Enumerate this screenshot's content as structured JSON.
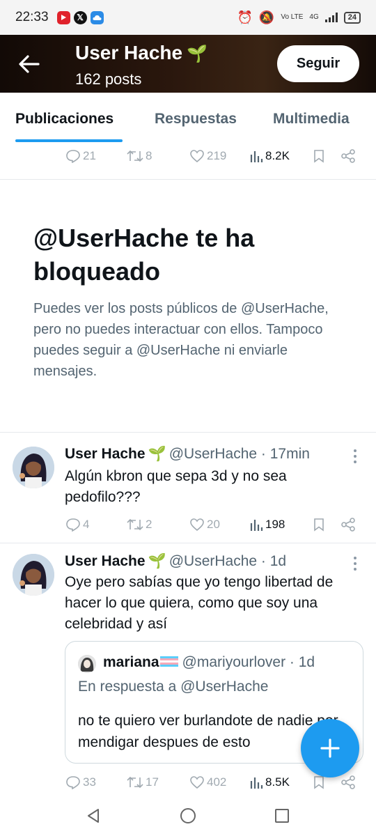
{
  "status_bar": {
    "time": "22:33",
    "notification_icons": [
      "youtube-icon",
      "x-icon",
      "cloud-icon"
    ],
    "volte": "Vo LTE",
    "network": "4G",
    "battery": "24"
  },
  "header": {
    "name": "User Hache",
    "posts_count": "162 posts",
    "follow_label": "Seguir"
  },
  "tabs": [
    {
      "label": "Publicaciones",
      "active": true
    },
    {
      "label": "Respuestas",
      "active": false
    },
    {
      "label": "Multimedia",
      "active": false
    }
  ],
  "top_actions": {
    "replies": "21",
    "reposts": "8",
    "likes": "219",
    "views": "8.2K"
  },
  "blocked": {
    "title": "@UserHache te ha bloqueado",
    "description": "Puedes ver los posts públicos de @UserHache, pero no puedes interactuar con ellos. Tampoco puedes seguir a @UserHache ni enviarle mensajes."
  },
  "tweets": [
    {
      "name": "User Hache",
      "handle": "@UserHache",
      "time": "· 17min",
      "text": "Algún kbron que sepa 3d y no sea pedofilo???",
      "replies": "4",
      "reposts": "2",
      "likes": "20",
      "views": "198"
    },
    {
      "name": "User Hache",
      "handle": "@UserHache",
      "time": "· 1d",
      "text": "Oye pero sabías que yo tengo libertad de hacer lo que quiera, como que soy una celebridad y así",
      "replies": "33",
      "reposts": "17",
      "likes": "402",
      "views": "8.5K",
      "quote": {
        "name": "mariana",
        "handle": "@mariyourlover",
        "time": "· 1d",
        "reply_to": "En respuesta a @UserHache",
        "text": "no te quiero ver burlandote de nadie por mendigar despues de esto"
      }
    }
  ],
  "colors": {
    "accent": "#1d9bf0",
    "secondary_text": "#536471",
    "sprout": "#7cc242"
  }
}
